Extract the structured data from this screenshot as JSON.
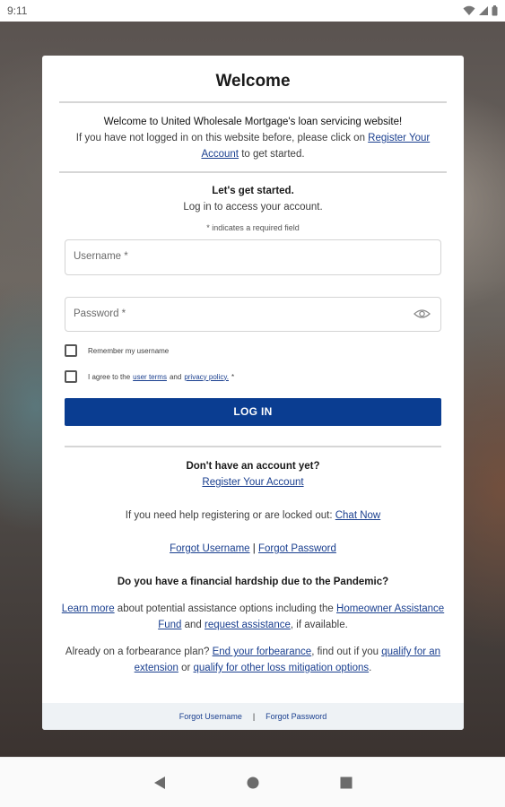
{
  "status_bar": {
    "time": "9:11"
  },
  "card": {
    "title": "Welcome",
    "welcome_heading": "Welcome to United Wholesale Mortgage's loan servicing website!",
    "welcome_text_before": "If you have not logged in on this website before, please click on ",
    "welcome_link": "Register Your Account",
    "welcome_text_after": " to get started.",
    "start_heading": "Let's get started.",
    "start_sub": "Log in to access your account.",
    "required_note": "* indicates a required field",
    "username_placeholder": "Username *",
    "password_placeholder": "Password *",
    "remember_label": "Remember my username",
    "agree_before": "I agree to the",
    "agree_user_terms": "user terms",
    "agree_and": "and",
    "agree_privacy": "privacy policy.",
    "agree_star": "*",
    "login_button": "LOG IN",
    "no_account": "Don't have an account yet?",
    "register_link": "Register Your Account",
    "help_text": "If you need help registering or are locked out: ",
    "chat_link": "Chat Now",
    "forgot_username": "Forgot Username",
    "forgot_sep": " | ",
    "forgot_password": "Forgot Password",
    "hardship_heading": "Do you have a financial hardship due to the Pandemic?",
    "learn_more": "Learn more",
    "learn_text1": " about potential assistance options including the ",
    "homeowner_fund": "Homeowner Assistance Fund",
    "learn_text2": " and ",
    "request_assistance": "request assistance",
    "learn_text3": ", if available.",
    "forb_text1": "Already on a forbearance plan? ",
    "end_forbearance": "End your forbearance",
    "forb_text2": ", find out if you ",
    "qualify_extension": "qualify for an extension",
    "forb_text3": " or ",
    "qualify_other": "qualify for other loss mitigation options",
    "forb_text4": "."
  },
  "footer": {
    "forgot_username": "Forgot Username",
    "separator": "|",
    "forgot_password": "Forgot Password"
  },
  "icons": {
    "wifi": "wifi-icon",
    "signal": "signal-icon",
    "battery": "battery-icon",
    "eye": "eye-icon",
    "back": "back-icon",
    "home": "home-icon",
    "recents": "recents-icon"
  },
  "colors": {
    "primary": "#0a3d91",
    "link": "#1a3f8f"
  }
}
